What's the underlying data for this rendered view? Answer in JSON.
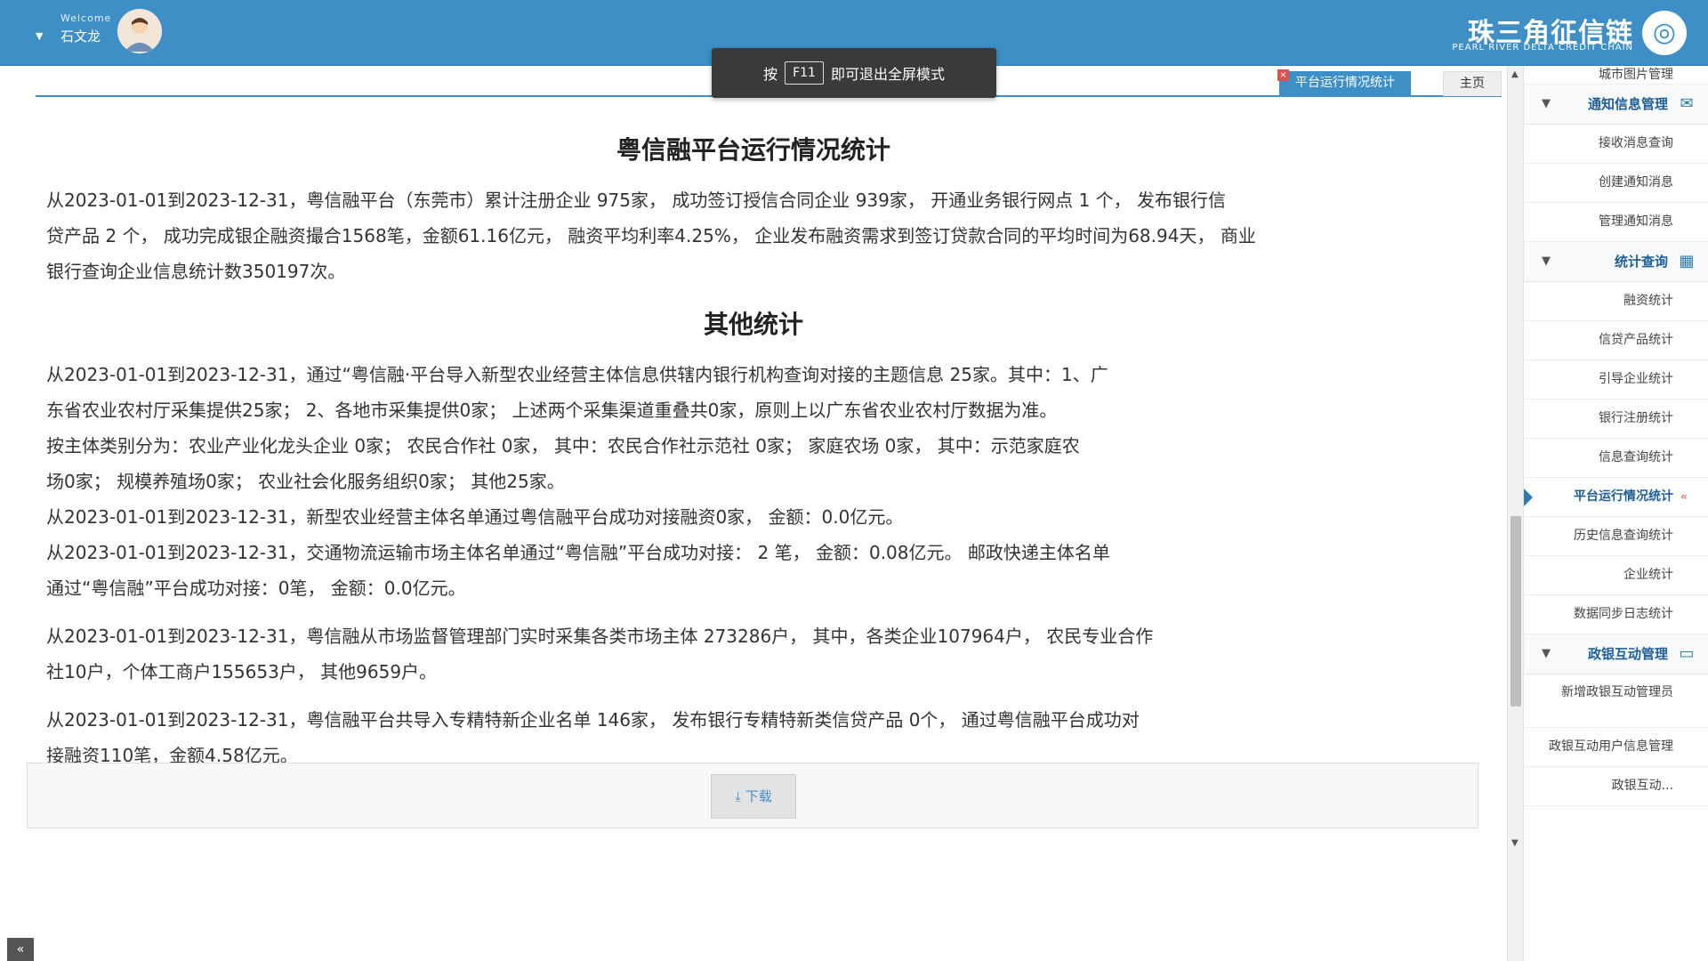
{
  "header": {
    "welcome": "Welcome",
    "username": "石文龙",
    "logo_cn": "珠三角征信链",
    "logo_en": "PEARL RIVER DELTA CREDIT CHAIN"
  },
  "fullscreen_toast": {
    "prefix": "按",
    "key": "F11",
    "suffix": "即可退出全屏模式"
  },
  "tabs": {
    "home": "主页",
    "active": "平台运行情况统计",
    "close": "×"
  },
  "main": {
    "title": "粤信融平台运行情况统计",
    "summary_lines": [
      "从2023-01-01到2023-12-31，粤信融平台（东莞市）累计注册企业 975家， 成功签订授信合同企业 939家， 开通业务银行网点 1 个， 发布银行信",
      "贷产品 2 个， 成功完成银企融资撮合1568笔，金额61.16亿元， 融资平均利率4.25%， 企业发布融资需求到签订贷款合同的平均时间为68.94天， 商业",
      "银行查询企业信息统计数350197次。"
    ],
    "other_title": "其他统计",
    "other_lines_1": [
      "从2023-01-01到2023-12-31，通过“粤信融·平台导入新型农业经营主体信息供辖内银行机构查询对接的主题信息 25家。其中：1、广",
      "东省农业农村厅采集提供25家； 2、各地市采集提供0家； 上述两个采集渠道重叠共0家，原则上以广东省农业农村厅数据为准。",
      "按主体类别分为：农业产业化龙头企业 0家； 农民合作社 0家，  其中：农民合作社示范社 0家； 家庭农场 0家，  其中：示范家庭农",
      "场0家； 规模养殖场0家； 农业社会化服务组织0家； 其他25家。"
    ],
    "other_lines_2": [
      "从2023-01-01到2023-12-31，新型农业经营主体名单通过粤信融平台成功对接融资0家， 金额：0.0亿元。",
      "从2023-01-01到2023-12-31，交通物流运输市场主体名单通过“粤信融”平台成功对接： 2 笔， 金额：0.08亿元。 邮政快递主体名单",
      "通过“粤信融”平台成功对接：0笔， 金额：0.0亿元。"
    ],
    "other_lines_3": [
      "从2023-01-01到2023-12-31，粤信融从市场监督管理部门实时采集各类市场主体 273286户， 其中，各类企业107964户， 农民专业合作",
      "社10户，个体工商户155653户， 其他9659户。"
    ],
    "other_lines_4": [
      "从2023-01-01到2023-12-31，粤信融平台共导入专精特新企业名单 146家， 发布银行专精特新类信贷产品 0个， 通过粤信融平台成功对",
      "接融资110笔，金额4.58亿元。"
    ],
    "download_label": "下载"
  },
  "sidebar": {
    "top_item": "城市图片管理",
    "group_notice": "通知信息管理",
    "notice_items": [
      "接收消息查询",
      "创建通知消息",
      "管理通知消息"
    ],
    "group_stats": "统计查询",
    "stats_items": [
      "融资统计",
      "信贷产品统计",
      "引导企业统计",
      "银行注册统计",
      "信息查询统计",
      "平台运行情况统计",
      "历史信息查询统计",
      "企业统计",
      "数据同步日志统计"
    ],
    "group_gov": "政银互动管理",
    "gov_items": [
      "新增政银互动管理员",
      "政银互动用户信息管理",
      "政银互动..."
    ]
  },
  "colors": {
    "primary": "#3d8fc6",
    "link": "#2a5db0"
  }
}
